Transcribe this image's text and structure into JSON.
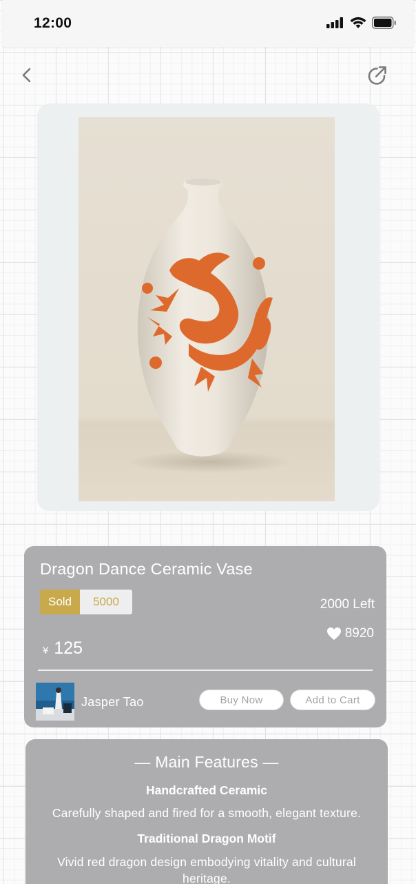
{
  "status_bar": {
    "time": "12:00"
  },
  "nav": {
    "back_icon": "chevron-left-icon",
    "share_icon": "share-icon"
  },
  "product": {
    "title": "Dragon Dance Ceramic Vase",
    "sold_label": "Sold",
    "sold_count": "5000",
    "stock_left": "2000 Left",
    "likes": "8920",
    "price_currency": "¥",
    "price": "125"
  },
  "seller": {
    "name": "Jasper Tao"
  },
  "actions": {
    "buy_now": "Buy Now",
    "add_to_cart": "Add to Cart"
  },
  "features": {
    "heading": "— Main Features —",
    "items": [
      {
        "title": "Handcrafted Ceramic",
        "description": "Carefully shaped and fired for a smooth, elegant texture."
      },
      {
        "title": "Traditional Dragon Motif",
        "description": "Vivid red dragon design embodying vitality and cultural heritage."
      }
    ]
  },
  "colors": {
    "gold": "#c8a94b",
    "card_gray": "#adadb0",
    "dragon_orange": "#dd6a2c"
  }
}
